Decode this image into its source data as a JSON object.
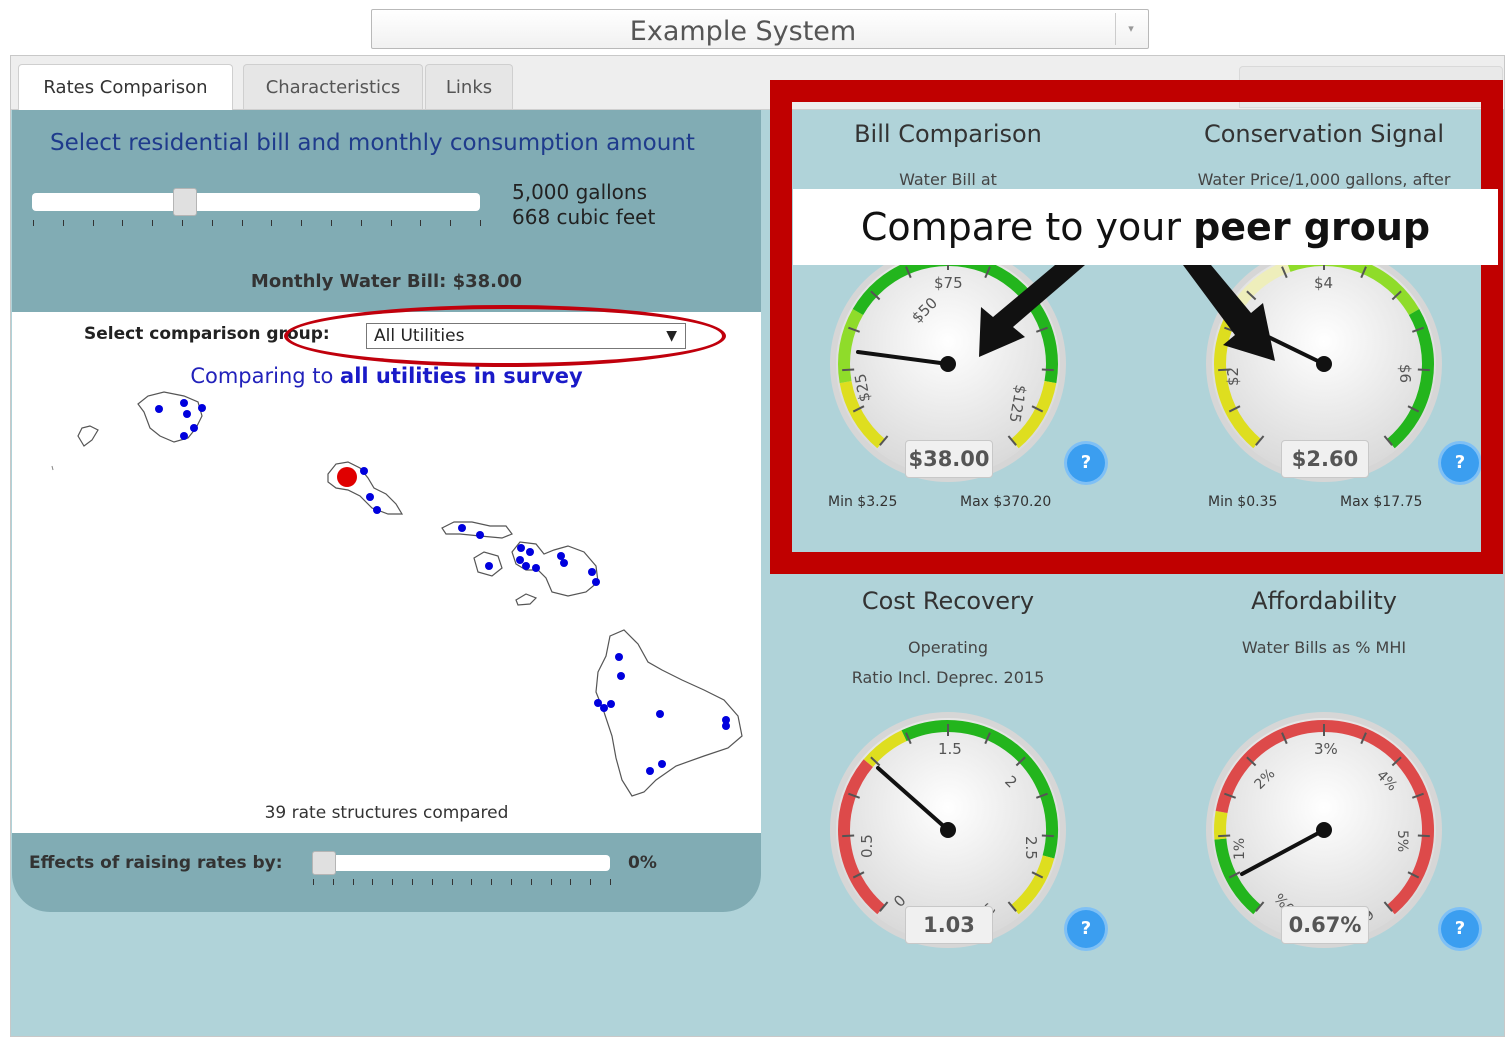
{
  "system_select": {
    "value": "Example System"
  },
  "tabs": [
    {
      "label": "Rates Comparison",
      "active": true
    },
    {
      "label": "Characteristics",
      "active": false
    },
    {
      "label": "Links",
      "active": false
    }
  ],
  "left_panel": {
    "title": "Select residential bill and monthly consumption amount",
    "consumption_gallons": "5,000 gallons",
    "consumption_cubic_feet": "668 cubic feet",
    "monthly_bill": "Monthly Water Bill: $38.00",
    "comparison_label": "Select comparison group:",
    "comparison_value": "All Utilities",
    "comparing_prefix": "Comparing to ",
    "comparing_bold": "all utilities in survey",
    "rate_structures": "39 rate structures compared",
    "effects_label": "Effects of raising rates by:",
    "effects_value": "0%",
    "consumption_slider_level": 0.33,
    "effects_slider_level": 0.0
  },
  "gauges": {
    "bill": {
      "title": "Bill Comparison",
      "subtitle": "Water Bill at",
      "value": "$38.00",
      "min": "Min $3.25",
      "max": "Max $370.20",
      "ticks": [
        "$25",
        "$50",
        "$75",
        "$125"
      ],
      "help": "?"
    },
    "conservation": {
      "title": "Conservation Signal",
      "subtitle": "Water Price/1,000 gallons, after",
      "value": "$2.60",
      "min": "Min $0.35",
      "max": "Max $17.75",
      "ticks": [
        "$2",
        "$4",
        "$6"
      ],
      "help": "?"
    },
    "cost_recovery": {
      "title": "Cost Recovery",
      "subtitle1": "Operating",
      "subtitle2": "Ratio Incl. Deprec. 2015",
      "value": "1.03",
      "ticks": [
        "0",
        "0.5",
        "1.5",
        "2",
        "2.5",
        "3"
      ],
      "help": "?"
    },
    "affordability": {
      "title": "Affordability",
      "subtitle": "Water Bills as % MHI",
      "value": "0.67%",
      "ticks": [
        "0%",
        "1%",
        "2%",
        "3%",
        "4%",
        "5%",
        "6%"
      ],
      "help": "?"
    }
  },
  "banner": {
    "prefix": "Compare to your ",
    "bold": "peer group"
  },
  "colors": {
    "red_highlight": "#c00000",
    "panel_bg": "#b0d3d9",
    "card_bg": "#81acb4",
    "map_dot": "#0000dd",
    "selected_dot": "#e00000"
  }
}
